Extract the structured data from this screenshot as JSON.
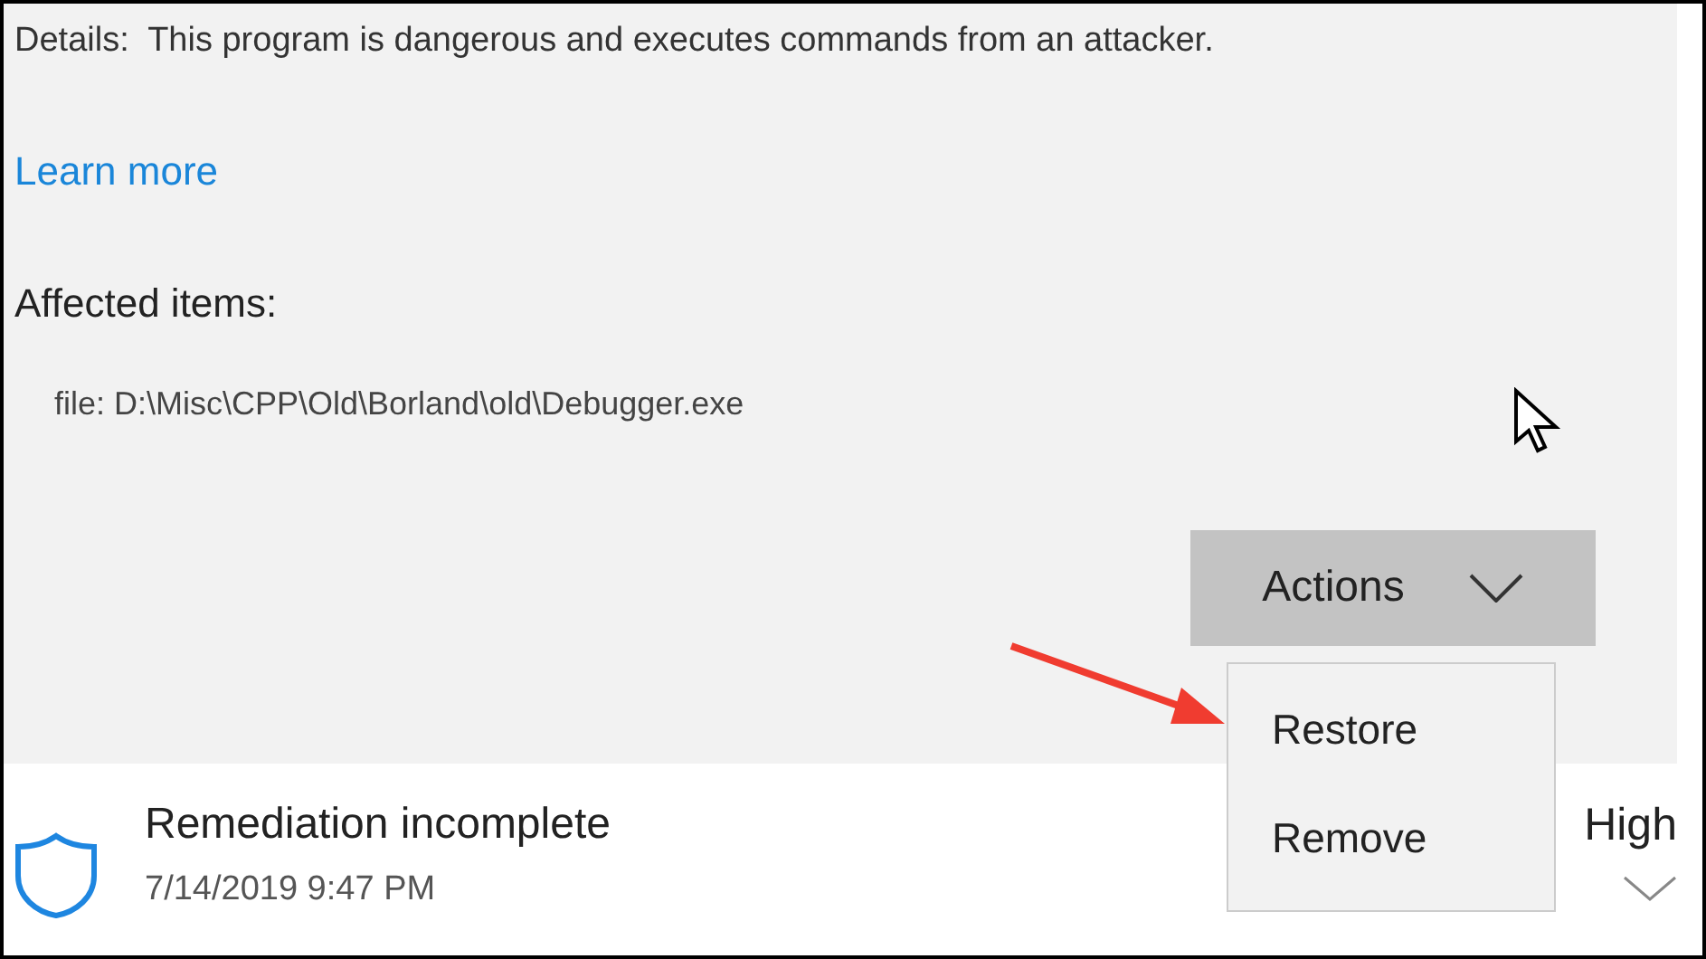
{
  "details": "Details:  This program is dangerous and executes commands from an attacker.",
  "learn_more": "Learn more",
  "affected_heading": "Affected items:",
  "affected_items": [
    "file: D:\\Misc\\CPP\\Old\\Borland\\old\\Debugger.exe"
  ],
  "actions_button": {
    "label": "Actions",
    "expanded": true
  },
  "actions_menu": [
    {
      "label": "Restore"
    },
    {
      "label": "Remove"
    }
  ],
  "threat": {
    "title": "Remediation incomplete",
    "date": "7/14/2019 9:47 PM",
    "severity": "High"
  }
}
